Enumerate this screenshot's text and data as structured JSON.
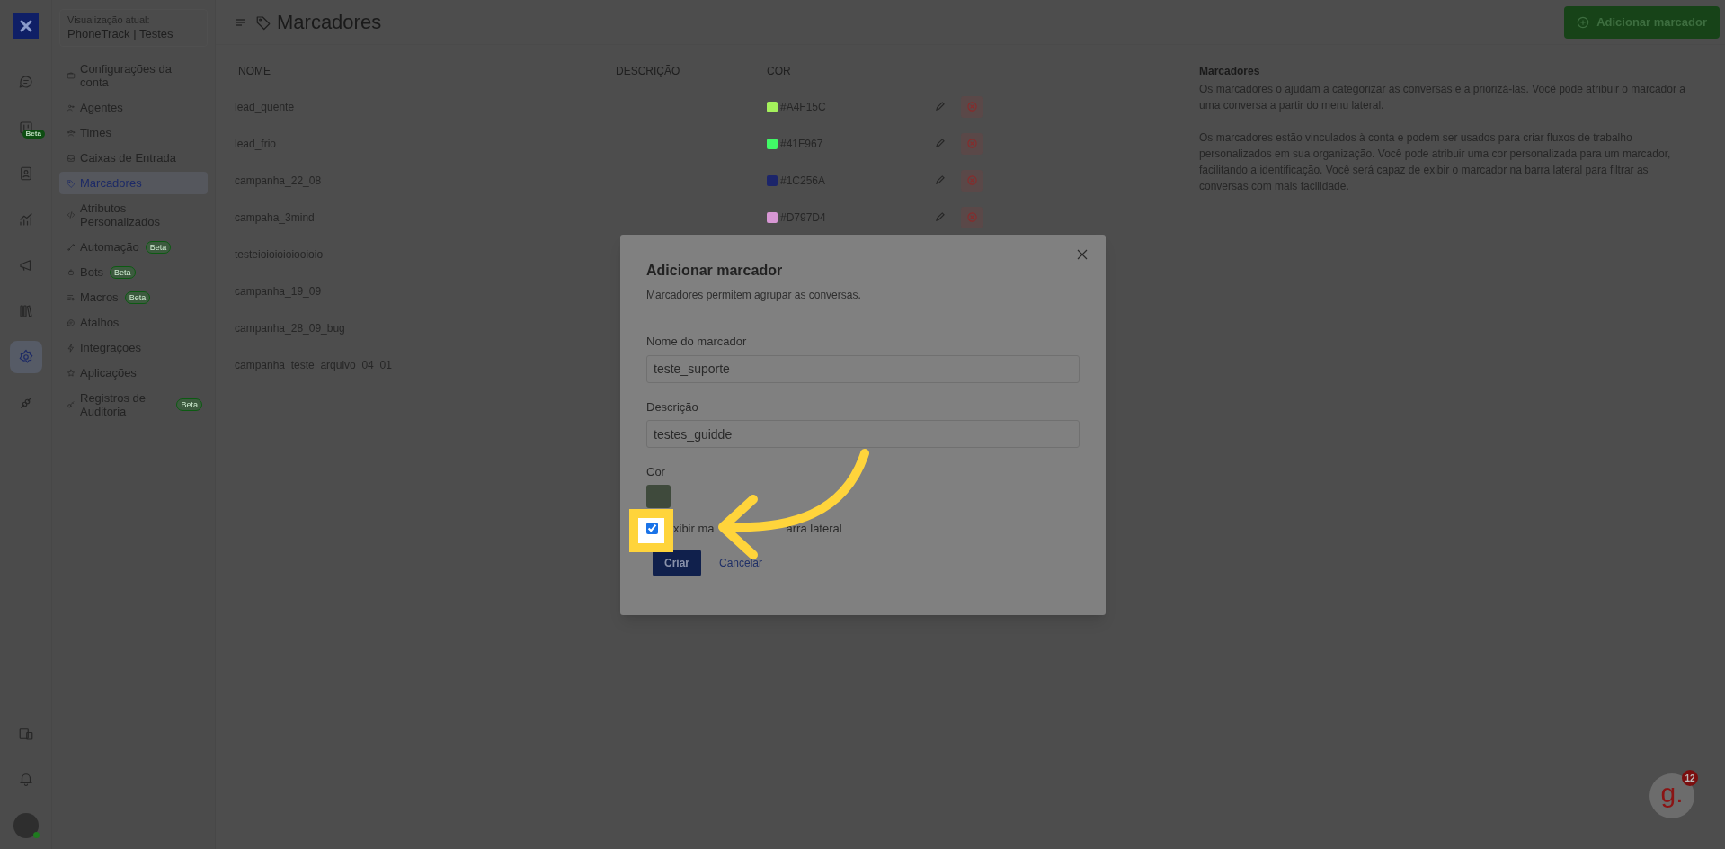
{
  "rail": {
    "items": [
      {
        "kind": "chat",
        "selected": false
      },
      {
        "kind": "kanban",
        "selected": false,
        "beta": "Beta"
      },
      {
        "kind": "contacts",
        "selected": false
      },
      {
        "kind": "reports",
        "selected": false
      },
      {
        "kind": "campaigns",
        "selected": false
      },
      {
        "kind": "library",
        "selected": false
      },
      {
        "kind": "settings",
        "selected": true
      },
      {
        "kind": "integrations",
        "selected": false
      }
    ],
    "bottom": [
      {
        "kind": "panel"
      },
      {
        "kind": "bell"
      },
      {
        "kind": "avatar"
      }
    ]
  },
  "account": {
    "caption": "Visualização atual:",
    "name": "PhoneTrack | Testes"
  },
  "settings_nav": [
    {
      "label": "Configurações da conta",
      "kind": "briefcase",
      "selected": false
    },
    {
      "label": "Agentes",
      "kind": "people",
      "selected": false
    },
    {
      "label": "Times",
      "kind": "team",
      "selected": false
    },
    {
      "label": "Caixas de Entrada",
      "kind": "inbox",
      "selected": false
    },
    {
      "label": "Marcadores",
      "kind": "tag",
      "selected": true
    },
    {
      "label": "Atributos Personalizados",
      "kind": "code",
      "selected": false
    },
    {
      "label": "Automação",
      "kind": "automation",
      "selected": false,
      "badge": "Beta"
    },
    {
      "label": "Bots",
      "kind": "bot",
      "selected": false,
      "badge": "Beta"
    },
    {
      "label": "Macros",
      "kind": "macro",
      "selected": false,
      "badge": "Beta"
    },
    {
      "label": "Atalhos",
      "kind": "chat",
      "selected": false
    },
    {
      "label": "Integrações",
      "kind": "bolt",
      "selected": false
    },
    {
      "label": "Aplicações",
      "kind": "star",
      "selected": false
    },
    {
      "label": "Registros de Auditoria",
      "kind": "key",
      "selected": false,
      "badge": "Beta"
    }
  ],
  "header": {
    "title": "Marcadores",
    "add_button": "Adicionar marcador"
  },
  "table": {
    "columns": [
      "NOME",
      "DESCRIÇÃO",
      "COR"
    ],
    "rows": [
      {
        "name": "lead_quente",
        "color_code": "#A4F15C",
        "color": "#a4f15c"
      },
      {
        "name": "lead_frio",
        "color_code": "#41F967",
        "color": "#41f967"
      },
      {
        "name": "campanha_22_08",
        "color_code": "#1C256A",
        "color": "#1c256a"
      },
      {
        "name": "campaha_3mind",
        "color_code": "#D797D4",
        "color": "#d797d4"
      },
      {
        "name": "testeioioioioiooioio"
      },
      {
        "name": "campanha_19_09"
      },
      {
        "name": "campanha_28_09_bug"
      },
      {
        "name": "campanha_teste_arquivo_04_01"
      }
    ]
  },
  "info": {
    "title": "Marcadores",
    "paragraphs": [
      "Os marcadores o ajudam a categorizar as conversas e a priorizá-las. Você pode atribuir o marcador a uma conversa a partir do menu lateral.",
      "Os marcadores estão vinculados à conta e podem ser usados para criar fluxos de trabalho personalizados em sua organização. Você pode atribuir uma cor personalizada para um marcador, facilitando a identificação. Você será capaz de exibir o marcador na barra lateral para filtrar as conversas com mais facilidade."
    ]
  },
  "modal": {
    "title": "Adicionar marcador",
    "subtitle": "Marcadores permitem agrupar as conversas.",
    "name_label": "Nome do marcador",
    "name_value": "teste_suporte",
    "description_label": "Descrição",
    "description_value": "testes_guidde",
    "color_label": "Cor",
    "color": "#3f4a3c",
    "show_in_sidebar": {
      "label_parts": [
        "xibir ma",
        "arra lateral"
      ],
      "checked": true
    },
    "buttons": {
      "primary": "Criar",
      "secondary": "Cancelar"
    }
  },
  "help_widget": {
    "letter": "g.",
    "count": "12"
  }
}
